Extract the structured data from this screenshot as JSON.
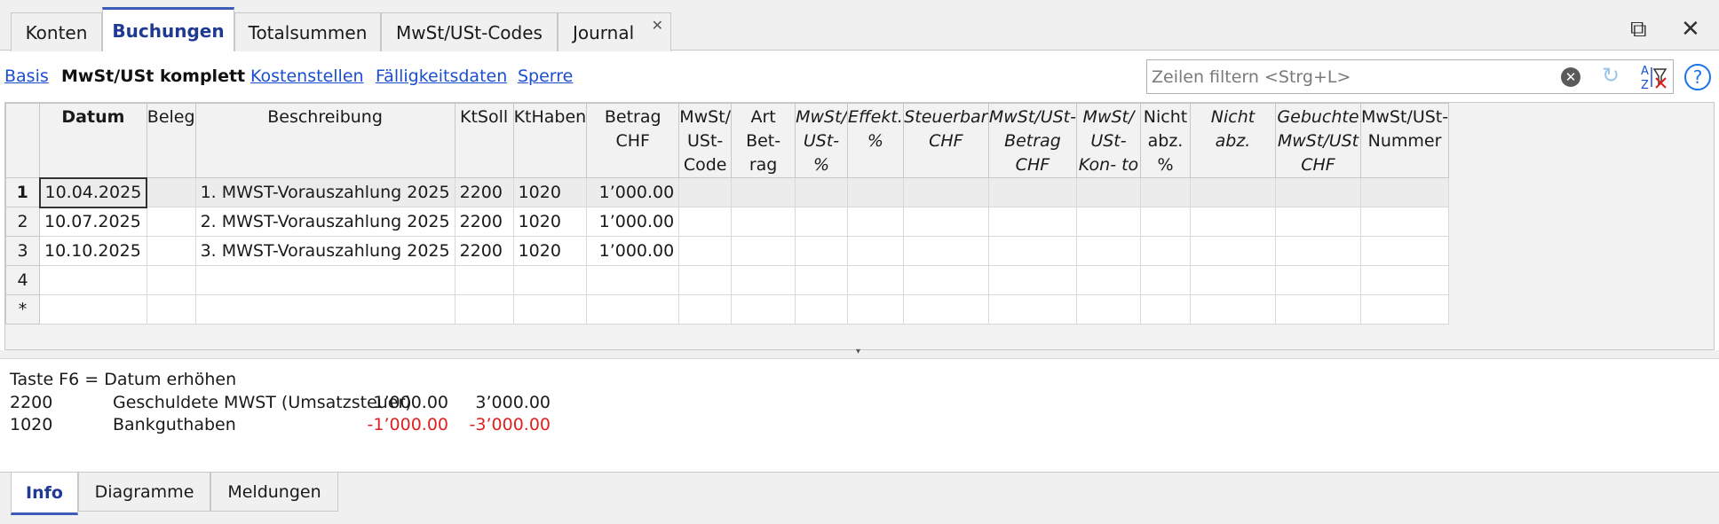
{
  "tabs": [
    "Konten",
    "Buchungen",
    "Totalsummen",
    "MwSt/USt-Codes",
    "Journal"
  ],
  "active_tab": "Buchungen",
  "views": [
    "Basis",
    "MwSt/USt komplett",
    "Kostenstellen",
    "Fälligkeitsdaten",
    "Sperre"
  ],
  "current_view": "MwSt/USt komplett",
  "filter": {
    "placeholder": "Zeilen filtern <Strg+L>",
    "value": ""
  },
  "columns": [
    {
      "label": "Datum",
      "style": "bold"
    },
    {
      "label": "Beleg",
      "style": "normal"
    },
    {
      "label": "Beschreibung",
      "style": "normal"
    },
    {
      "label": "KtSoll",
      "style": "normal"
    },
    {
      "label": "KtHaben",
      "style": "normal"
    },
    {
      "label": "Betrag CHF",
      "style": "normal"
    },
    {
      "label": "MwSt/ USt-Code",
      "style": "normal"
    },
    {
      "label": "Art Bet- rag",
      "style": "normal"
    },
    {
      "label": "MwSt/ USt-%",
      "style": "italic"
    },
    {
      "label": "Effekt. %",
      "style": "italic"
    },
    {
      "label": "Steuerbar CHF",
      "style": "italic"
    },
    {
      "label": "MwSt/USt- Betrag CHF",
      "style": "italic"
    },
    {
      "label": "MwSt/ USt-Kon- to",
      "style": "italic"
    },
    {
      "label": "Nicht abz. %",
      "style": "normal"
    },
    {
      "label": "Nicht abz.",
      "style": "italic"
    },
    {
      "label": "Gebuchte MwSt/USt CHF",
      "style": "italic"
    },
    {
      "label": "MwSt/USt- Nummer",
      "style": "normal"
    }
  ],
  "rows": [
    {
      "num": "1",
      "cells": [
        "10.04.2025",
        "",
        "1. MWST-Vorauszahlung 2025",
        "2200",
        "1020",
        "1’000.00",
        "",
        "",
        "",
        "",
        "",
        "",
        "",
        "",
        "",
        "",
        ""
      ]
    },
    {
      "num": "2",
      "cells": [
        "10.07.2025",
        "",
        "2. MWST-Vorauszahlung 2025",
        "2200",
        "1020",
        "1’000.00",
        "",
        "",
        "",
        "",
        "",
        "",
        "",
        "",
        "",
        "",
        ""
      ]
    },
    {
      "num": "3",
      "cells": [
        "10.10.2025",
        "",
        "3. MWST-Vorauszahlung 2025",
        "2200",
        "1020",
        "1’000.00",
        "",
        "",
        "",
        "",
        "",
        "",
        "",
        "",
        "",
        "",
        ""
      ]
    },
    {
      "num": "4",
      "cells": [
        "",
        "",
        "",
        "",
        "",
        "",
        "",
        "",
        "",
        "",
        "",
        "",
        "",
        "",
        "",
        "",
        ""
      ]
    },
    {
      "num": "*",
      "cells": [
        "",
        "",
        "",
        "",
        "",
        "",
        "",
        "",
        "",
        "",
        "",
        "",
        "",
        "",
        "",
        "",
        ""
      ]
    }
  ],
  "info": {
    "hint": "Taste F6 = Datum erhöhen",
    "accounts": [
      {
        "account": "2200",
        "name": "Geschuldete MWST (Umsatzsteuer)",
        "amount": "1’000.00",
        "balance": "3’000.00",
        "negative": false
      },
      {
        "account": "1020",
        "name": "Bankguthaben",
        "amount": "-1’000.00",
        "balance": "-3’000.00",
        "negative": true
      }
    ]
  },
  "bottom_tabs": [
    "Info",
    "Diagramme",
    "Meldungen"
  ],
  "active_bottom_tab": "Info",
  "colors": {
    "accent": "#3b5cb8",
    "link": "#1a4fd0",
    "negative": "#e02020"
  }
}
